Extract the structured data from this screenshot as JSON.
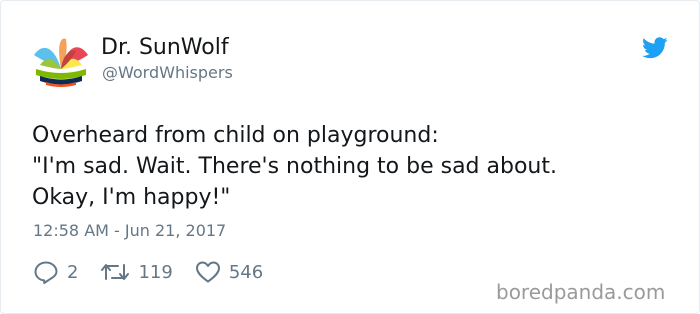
{
  "user": {
    "display_name": "Dr. SunWolf",
    "handle": "@WordWhispers"
  },
  "tweet": {
    "lines": [
      "Overheard from child on playground:",
      "\"I'm sad. Wait. There's nothing to be sad about.",
      "Okay, I'm happy!\""
    ],
    "timestamp": "12:58 AM - Jun 21, 2017"
  },
  "actions": {
    "replies": "2",
    "retweets": "119",
    "likes": "546"
  },
  "icons": {
    "reply": "reply-icon",
    "retweet": "retweet-icon",
    "like": "heart-icon",
    "brand": "twitter-bird-icon"
  },
  "colors": {
    "brand": "#1da1f2",
    "muted": "#657786"
  },
  "watermark": "boredpanda.com"
}
